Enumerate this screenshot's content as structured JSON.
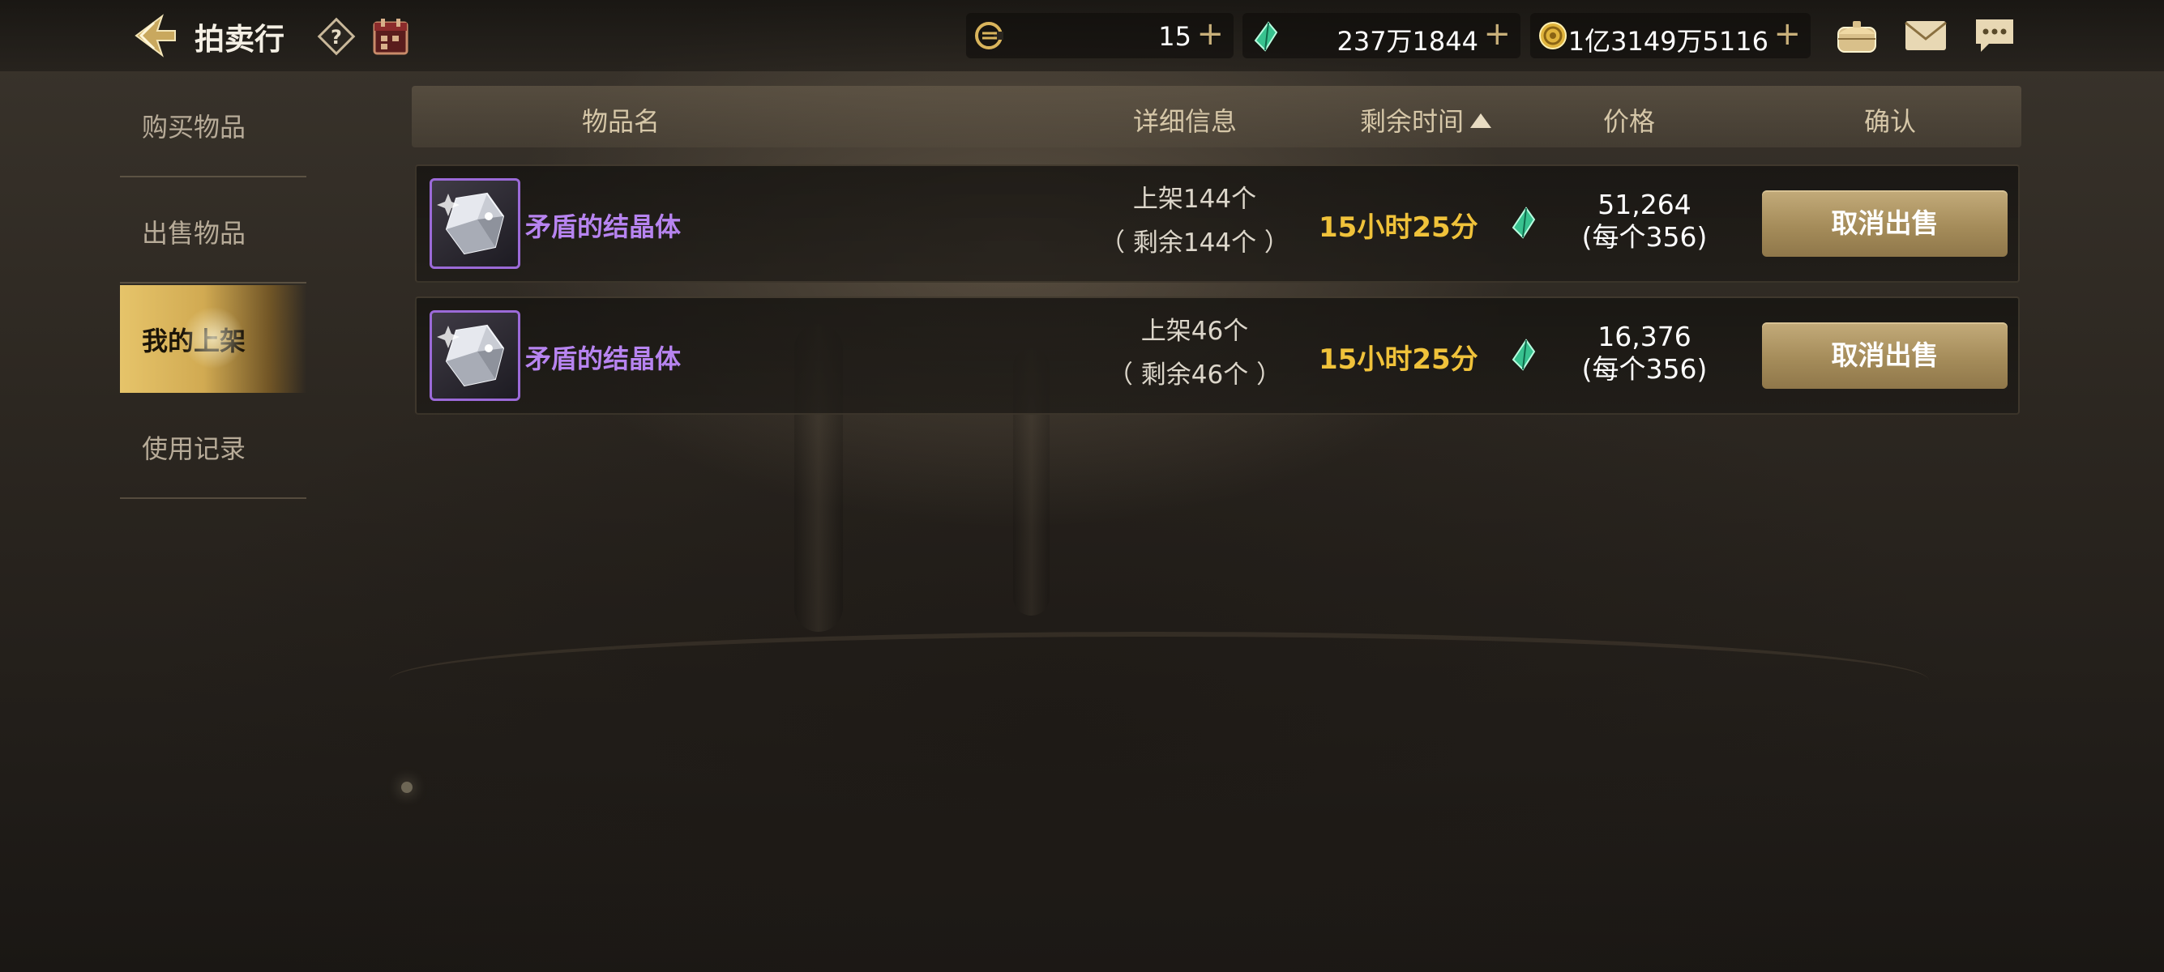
{
  "header": {
    "title": "拍卖行",
    "currencies": [
      {
        "icon": "c-coin-icon",
        "value": "15"
      },
      {
        "icon": "green-gem-icon",
        "value": "237万1844"
      },
      {
        "icon": "gold-coin-icon",
        "value": "1亿3149万5116"
      }
    ],
    "plus_glyph": "+"
  },
  "sidebar": {
    "items": [
      {
        "label": "购买物品",
        "active": false
      },
      {
        "label": "出售物品",
        "active": false
      },
      {
        "label": "我的上架",
        "active": true
      },
      {
        "label": "使用记录",
        "active": false
      }
    ]
  },
  "table": {
    "columns": {
      "name": "物品名",
      "detail": "详细信息",
      "time": "剩余时间",
      "price": "价格",
      "confirm": "确认"
    },
    "sort": {
      "column": "time",
      "direction": "ascending"
    },
    "rows": [
      {
        "item_name": "矛盾的结晶体",
        "detail_line1": "上架144个",
        "detail_line2": "（ 剩余144个 ）",
        "time_left": "15小时25分",
        "price_total": "51,264",
        "price_each": "(每个356)",
        "action": "取消出售"
      },
      {
        "item_name": "矛盾的结晶体",
        "detail_line1": "上架46个",
        "detail_line2": "（ 剩余46个 ）",
        "time_left": "15小时25分",
        "price_total": "16,376",
        "price_each": "(每个356)",
        "action": "取消出售"
      }
    ]
  },
  "colors": {
    "accent_gold": "#f0c23a",
    "item_purple": "#b784f0",
    "button_gold": "#a58c5a",
    "active_tab": "#e6c46a"
  }
}
